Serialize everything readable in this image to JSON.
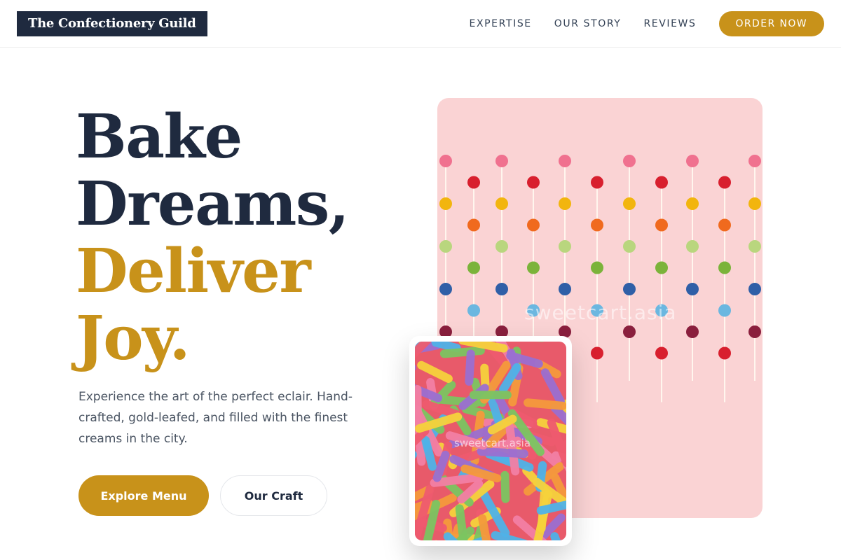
{
  "header": {
    "logo_text": "The Confectionery Guild",
    "nav": [
      "EXPERTISE",
      "OUR STORY",
      "REVIEWS"
    ],
    "cta_label": "ORDER NOW"
  },
  "hero": {
    "headline_dark": [
      "Bake",
      "Dreams,"
    ],
    "headline_gold": [
      "Deliver",
      "Joy."
    ],
    "description": "Experience the art of the perfect eclair. Hand-crafted, gold-leafed, and filled with the finest creams in the city.",
    "primary_button": "Explore Menu",
    "secondary_button": "Our Craft"
  },
  "images": {
    "lollipop_watermark": "sweetcart.asia",
    "gummy_watermark": "sweetcart.asia"
  },
  "colors": {
    "navy": "#1f2a3f",
    "gold": "#c8921a",
    "pink_bg": "#fad3d4"
  }
}
